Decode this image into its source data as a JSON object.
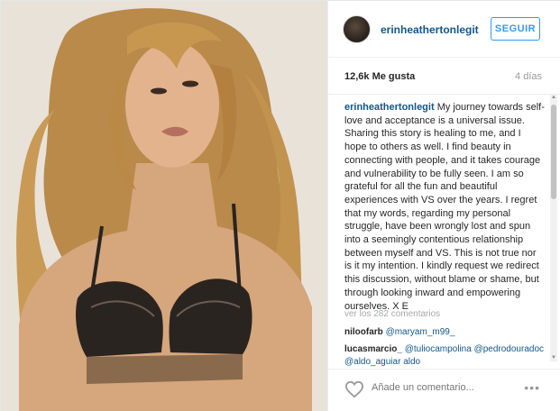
{
  "post": {
    "username": "erinheathertonlegit",
    "follow_label": "SEGUIR",
    "likes": "12,6k Me gusta",
    "age": "4 días",
    "caption_user": "erinheathertonlegit",
    "caption_text": "My journey towards self-love and acceptance is a universal issue. Sharing this story is healing to me, and I hope to others as well. I find beauty in connecting with people, and it takes courage and vulnerability to be fully seen. I am so grateful for all the fun and beautiful experiences with VS over the years. I regret that my words, regarding my personal struggle, have been wrongly lost and spun into a seemingly contentious relationship between myself and VS. This is not true nor is it my intention. I kindly request we redirect this discussion, without blame or shame, but through looking inward and empowering ourselves. X E",
    "view_all": "ver los 282 comentarios",
    "comments": [
      {
        "user": "niloofarb",
        "text": "@maryam_m99_"
      },
      {
        "user": "lucasmarcio_",
        "text": "@tuliocampolina @pedrodouradoc @aldo_aguiar aldo"
      }
    ],
    "add_comment_placeholder": "Añade un comentario..."
  },
  "icons": {
    "like": "heart-icon",
    "more": "more-options-icon",
    "scroll_up": "triangle-up",
    "scroll_down": "triangle-down"
  },
  "colors": {
    "link": "#125688",
    "follow": "#3897f0",
    "muted": "#999999"
  }
}
